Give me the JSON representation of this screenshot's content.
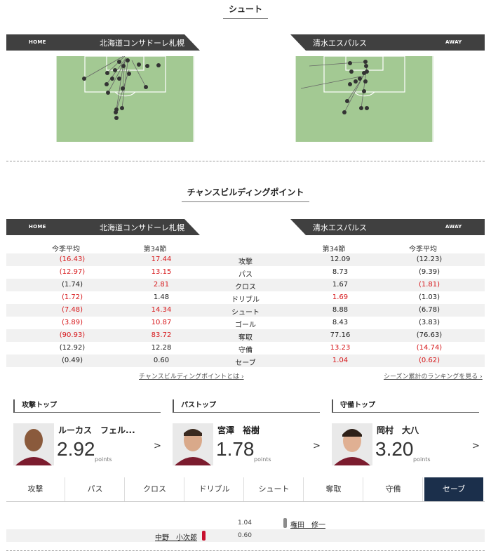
{
  "shot_section": {
    "title": "シュート"
  },
  "cbp_section": {
    "title": "チャンスビルディングポイント"
  },
  "home": {
    "side": "HOME",
    "name": "北海道コンサドーレ札幌"
  },
  "away": {
    "side": "AWAY",
    "name": "清水エスパルス"
  },
  "stats": {
    "headers": {
      "season_avg": "今季平均",
      "round": "第34節"
    },
    "rows": [
      {
        "label": "攻撃",
        "home_avg": "(16.43)",
        "home": "17.44",
        "away": "12.09",
        "away_avg": "(12.23)"
      },
      {
        "label": "パス",
        "home_avg": "(12.97)",
        "home": "13.15",
        "away": "8.73",
        "away_avg": "(9.39)"
      },
      {
        "label": "クロス",
        "home_avg": "(1.74)",
        "home": "2.81",
        "away": "1.67",
        "away_avg": "(1.81)"
      },
      {
        "label": "ドリブル",
        "home_avg": "(1.72)",
        "home": "1.48",
        "away": "1.69",
        "away_avg": "(1.03)"
      },
      {
        "label": "シュート",
        "home_avg": "(7.48)",
        "home": "14.34",
        "away": "8.88",
        "away_avg": "(6.78)"
      },
      {
        "label": "ゴール",
        "home_avg": "(3.89)",
        "home": "10.87",
        "away": "8.43",
        "away_avg": "(3.83)"
      },
      {
        "label": "奪取",
        "home_avg": "(90.93)",
        "home": "83.72",
        "away": "77.16",
        "away_avg": "(76.63)"
      },
      {
        "label": "守備",
        "home_avg": "(12.92)",
        "home": "12.28",
        "away": "13.23",
        "away_avg": "(14.74)"
      },
      {
        "label": "セーブ",
        "home_avg": "(0.49)",
        "home": "0.60",
        "away": "1.04",
        "away_avg": "(0.62)"
      }
    ],
    "link_about": "チャンスビルディングポイントとは",
    "link_ranking": "シーズン累計のランキングを見る"
  },
  "tops": [
    {
      "title": "攻撃トップ",
      "player": "ルーカス　フェル...",
      "value": "2.92",
      "unit": "points"
    },
    {
      "title": "パストップ",
      "player": "宮澤　裕樹",
      "value": "1.78",
      "unit": "points"
    },
    {
      "title": "守備トップ",
      "player": "岡村　大八",
      "value": "3.20",
      "unit": "points"
    }
  ],
  "tabs": [
    "攻撃",
    "パス",
    "クロス",
    "ドリブル",
    "シュート",
    "奪取",
    "守備",
    "セーブ"
  ],
  "active_tab": "セーブ",
  "save_rows": [
    {
      "value": "1.04",
      "player": "権田　修一",
      "team": "away"
    },
    {
      "value": "0.60",
      "player": "中野　小次郎",
      "team": "home"
    }
  ],
  "colors": {
    "bar": "#404040",
    "pitch": "#a3c993",
    "highlight": "#d7191c",
    "active_tab": "#1b2f4b",
    "home_bar": "#c8102e",
    "away_bar": "#8c8c8c"
  }
}
